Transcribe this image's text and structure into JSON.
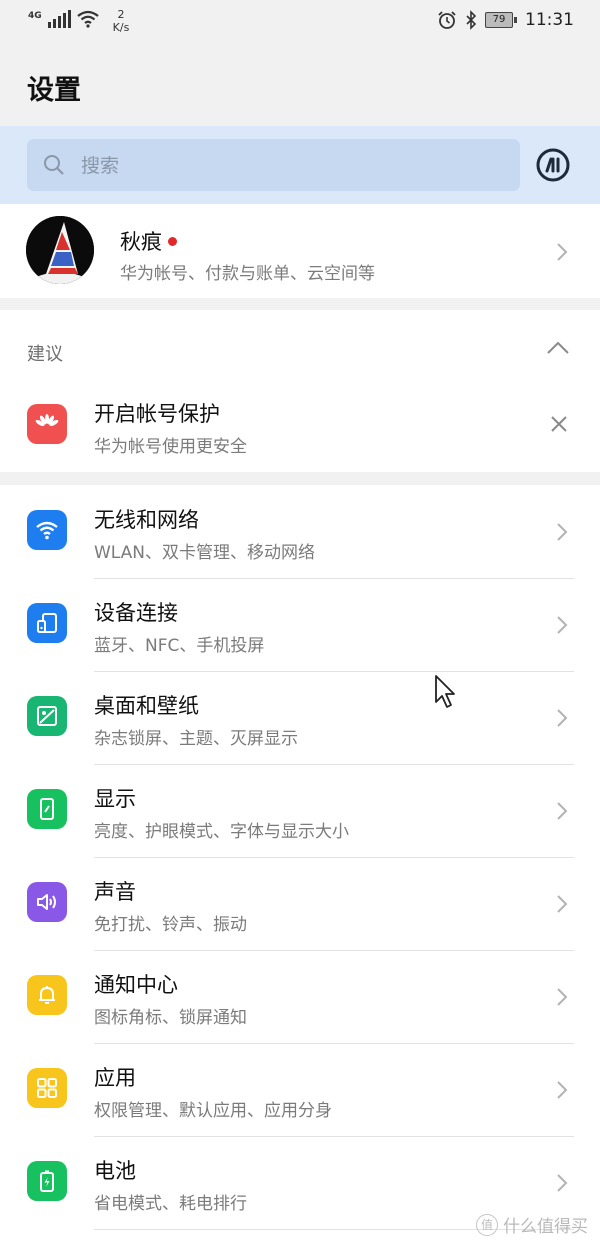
{
  "status_bar": {
    "network_type": "4G",
    "speed_value": "2",
    "speed_unit": "K/s",
    "battery_level": "79",
    "time": "11:31"
  },
  "header": {
    "title": "设置"
  },
  "search": {
    "placeholder": "搜索"
  },
  "profile": {
    "name": "秋痕",
    "subtitle": "华为帐号、付款与账单、云空间等"
  },
  "suggestions": {
    "section_label": "建议",
    "item": {
      "title": "开启帐号保护",
      "subtitle": "华为帐号使用更安全",
      "icon": "huawei-logo-icon"
    }
  },
  "settings_items": [
    {
      "title": "无线和网络",
      "subtitle": "WLAN、双卡管理、移动网络",
      "icon": "wifi-icon",
      "color": "#1e7ef0"
    },
    {
      "title": "设备连接",
      "subtitle": "蓝牙、NFC、手机投屏",
      "icon": "device-connect-icon",
      "color": "#1e7ef0"
    },
    {
      "title": "桌面和壁纸",
      "subtitle": "杂志锁屏、主题、灭屏显示",
      "icon": "wallpaper-icon",
      "color": "#18b672"
    },
    {
      "title": "显示",
      "subtitle": "亮度、护眼模式、字体与显示大小",
      "icon": "display-icon",
      "color": "#18c160"
    },
    {
      "title": "声音",
      "subtitle": "免打扰、铃声、振动",
      "icon": "sound-icon",
      "color": "#8a58e6"
    },
    {
      "title": "通知中心",
      "subtitle": "图标角标、锁屏通知",
      "icon": "bell-icon",
      "color": "#f7c51b"
    },
    {
      "title": "应用",
      "subtitle": "权限管理、默认应用、应用分身",
      "icon": "apps-grid-icon",
      "color": "#f7c51b"
    },
    {
      "title": "电池",
      "subtitle": "省电模式、耗电排行",
      "icon": "battery-icon",
      "color": "#18c160"
    }
  ],
  "watermark": {
    "text": "什么值得买",
    "mark": "值"
  }
}
